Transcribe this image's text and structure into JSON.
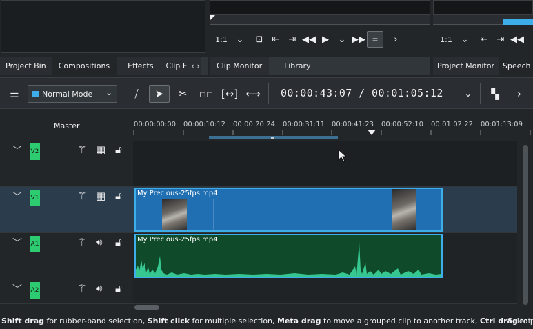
{
  "project_bin_tabs": [
    "Project Bin",
    "Compositions",
    "Effects",
    "Clip F"
  ],
  "clip_monitor": {
    "tabs": [
      "Clip Monitor",
      "Library"
    ],
    "zoom": "1:1"
  },
  "project_monitor": {
    "tabs": [
      "Project Monitor",
      "Speech Ed"
    ],
    "zoom": "1:1"
  },
  "toolbar": {
    "mode": "Normal Mode",
    "timecode": "00:00:43:07 / 00:01:05:12"
  },
  "timeline": {
    "master_label": "Master",
    "ruler_labels": [
      "00:00:00:00",
      "00:00:10:12",
      "00:00:20:24",
      "00:00:31:11",
      "00:00:41:23",
      "00:00:52:10",
      "00:01:02:22",
      "00:01:13:09"
    ],
    "tracks": [
      {
        "badge": "V2",
        "type": "video"
      },
      {
        "badge": "V1",
        "type": "video"
      },
      {
        "badge": "A1",
        "type": "audio"
      },
      {
        "badge": "A2",
        "type": "audio"
      }
    ],
    "video_clip_name": "My Precious-25fps.mp4",
    "audio_clip_name": "My Precious-25fps.mp4"
  },
  "status": {
    "k1": "Shift drag",
    "t1": " for rubber-band selection, ",
    "k2": "Shift click",
    "t2": " for multiple selection, ",
    "k3": "Meta drag",
    "t3": " to move a grouped clip to another track, ",
    "k4": "Ctrl drag",
    "t4": " to pan",
    "mode": "Select"
  },
  "colors": {
    "accent": "#3daee9",
    "track_badge": "#2ecc71",
    "video_clip": "#1f6fb2",
    "audio_clip": "#0f4a2a",
    "waveform": "#35c78f"
  }
}
